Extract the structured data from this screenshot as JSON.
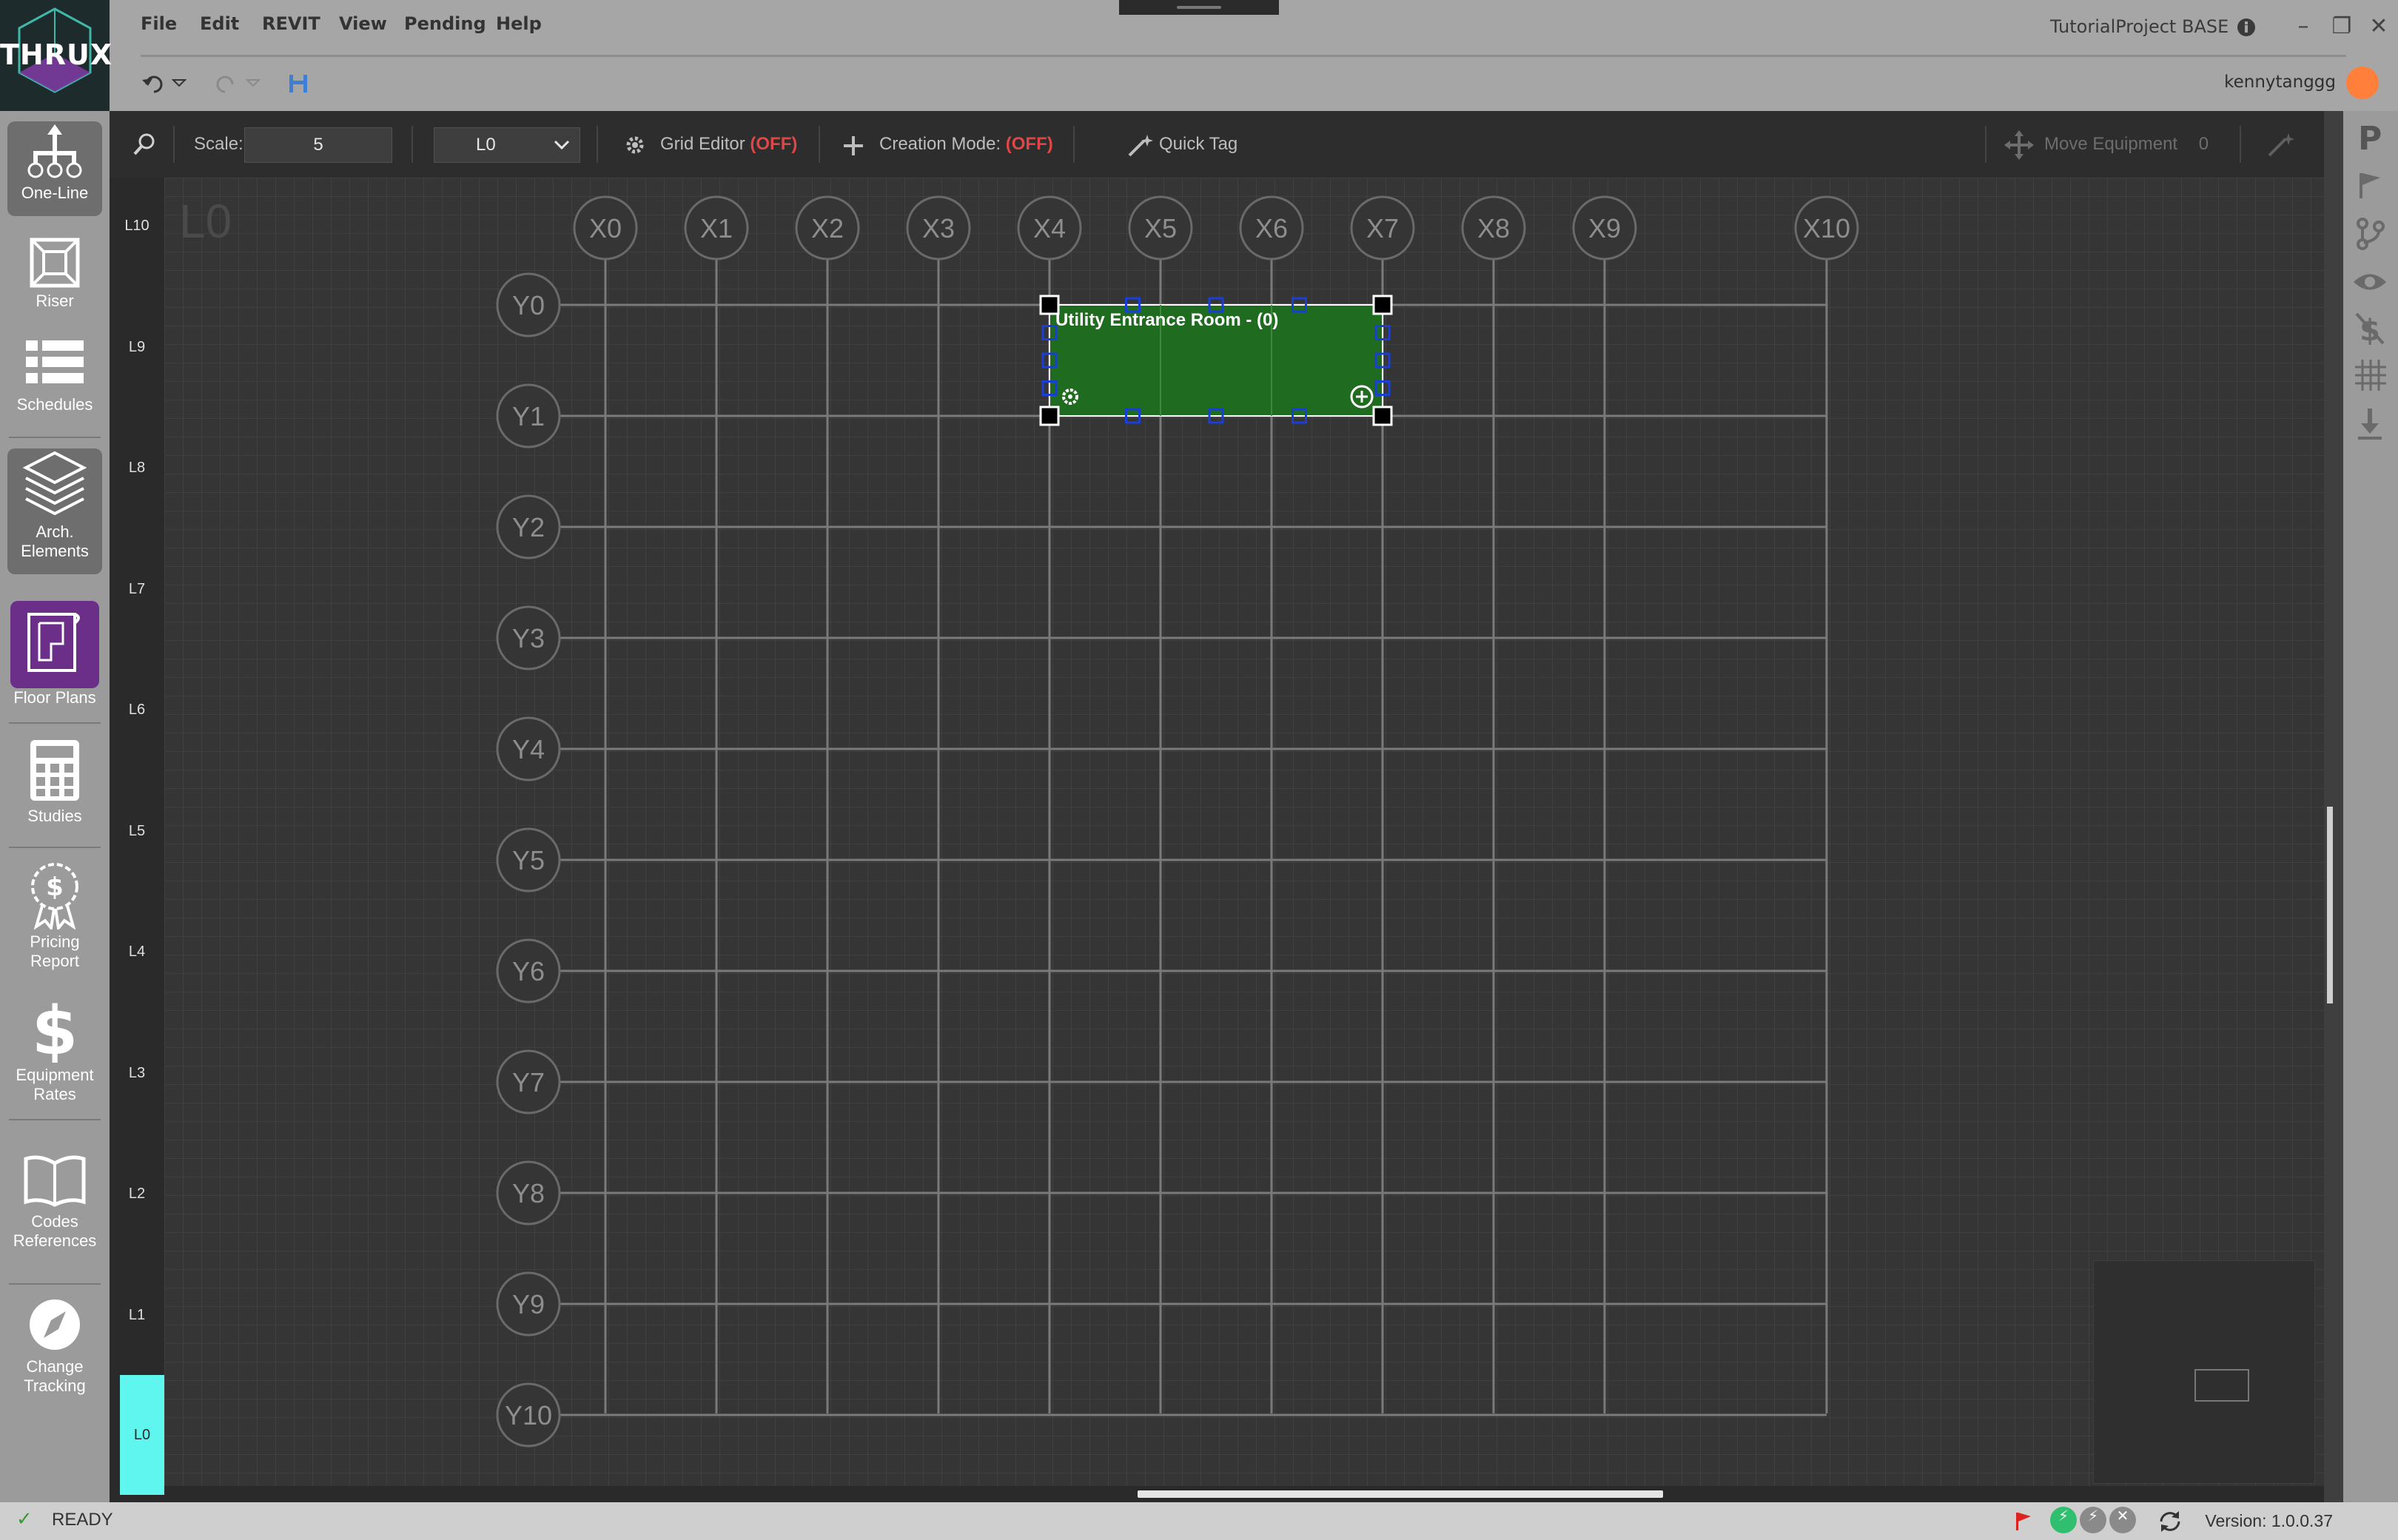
{
  "app": {
    "logo_text": "THRUX",
    "menu": [
      "File",
      "Edit",
      "REVIT",
      "View",
      "Pending",
      "Help"
    ],
    "project": "TutorialProject",
    "branch": "BASE",
    "user": "kennytanggg"
  },
  "leftnav": [
    {
      "label": "One-Line"
    },
    {
      "label": "Riser"
    },
    {
      "label": "Schedules"
    },
    {
      "label": "Arch. Elements"
    },
    {
      "label": "Floor Plans"
    },
    {
      "label": "Studies"
    },
    {
      "label": "Pricing Report"
    },
    {
      "label": "Equipment Rates"
    },
    {
      "label": "Codes References"
    },
    {
      "label": "Change Tracking"
    }
  ],
  "toolbar": {
    "scale_label": "Scale:",
    "scale_value": "5",
    "level_selected": "L0",
    "grid_editor_label": "Grid Editor",
    "grid_editor_state": "(OFF)",
    "creation_mode_label": "Creation Mode:",
    "creation_mode_state": "(OFF)",
    "quick_tag_label": "Quick Tag",
    "move_equipment_label": "Move Equipment",
    "move_equipment_count": "0"
  },
  "levels": [
    "L10",
    "L9",
    "L8",
    "L7",
    "L6",
    "L5",
    "L4",
    "L3",
    "L2",
    "L1",
    "L0"
  ],
  "canvas": {
    "level_watermark": "L0",
    "x_grids": [
      "X0",
      "X1",
      "X2",
      "X3",
      "X4",
      "X5",
      "X6",
      "X7",
      "X8",
      "X9",
      "X10"
    ],
    "y_grids": [
      "Y0",
      "Y1",
      "Y2",
      "Y3",
      "Y4",
      "Y5",
      "Y6",
      "Y7",
      "Y8",
      "Y9",
      "Y10"
    ],
    "room": {
      "label": "Utility Entrance Room - (0)",
      "color": "#1f6b1f"
    }
  },
  "status": {
    "ready": "READY",
    "version": "Version:  1.0.0.37"
  },
  "colors": {
    "accent_off": "#e04646",
    "active_level": "#5ff6ef",
    "floor_plans_active": "#6b2f8a"
  }
}
